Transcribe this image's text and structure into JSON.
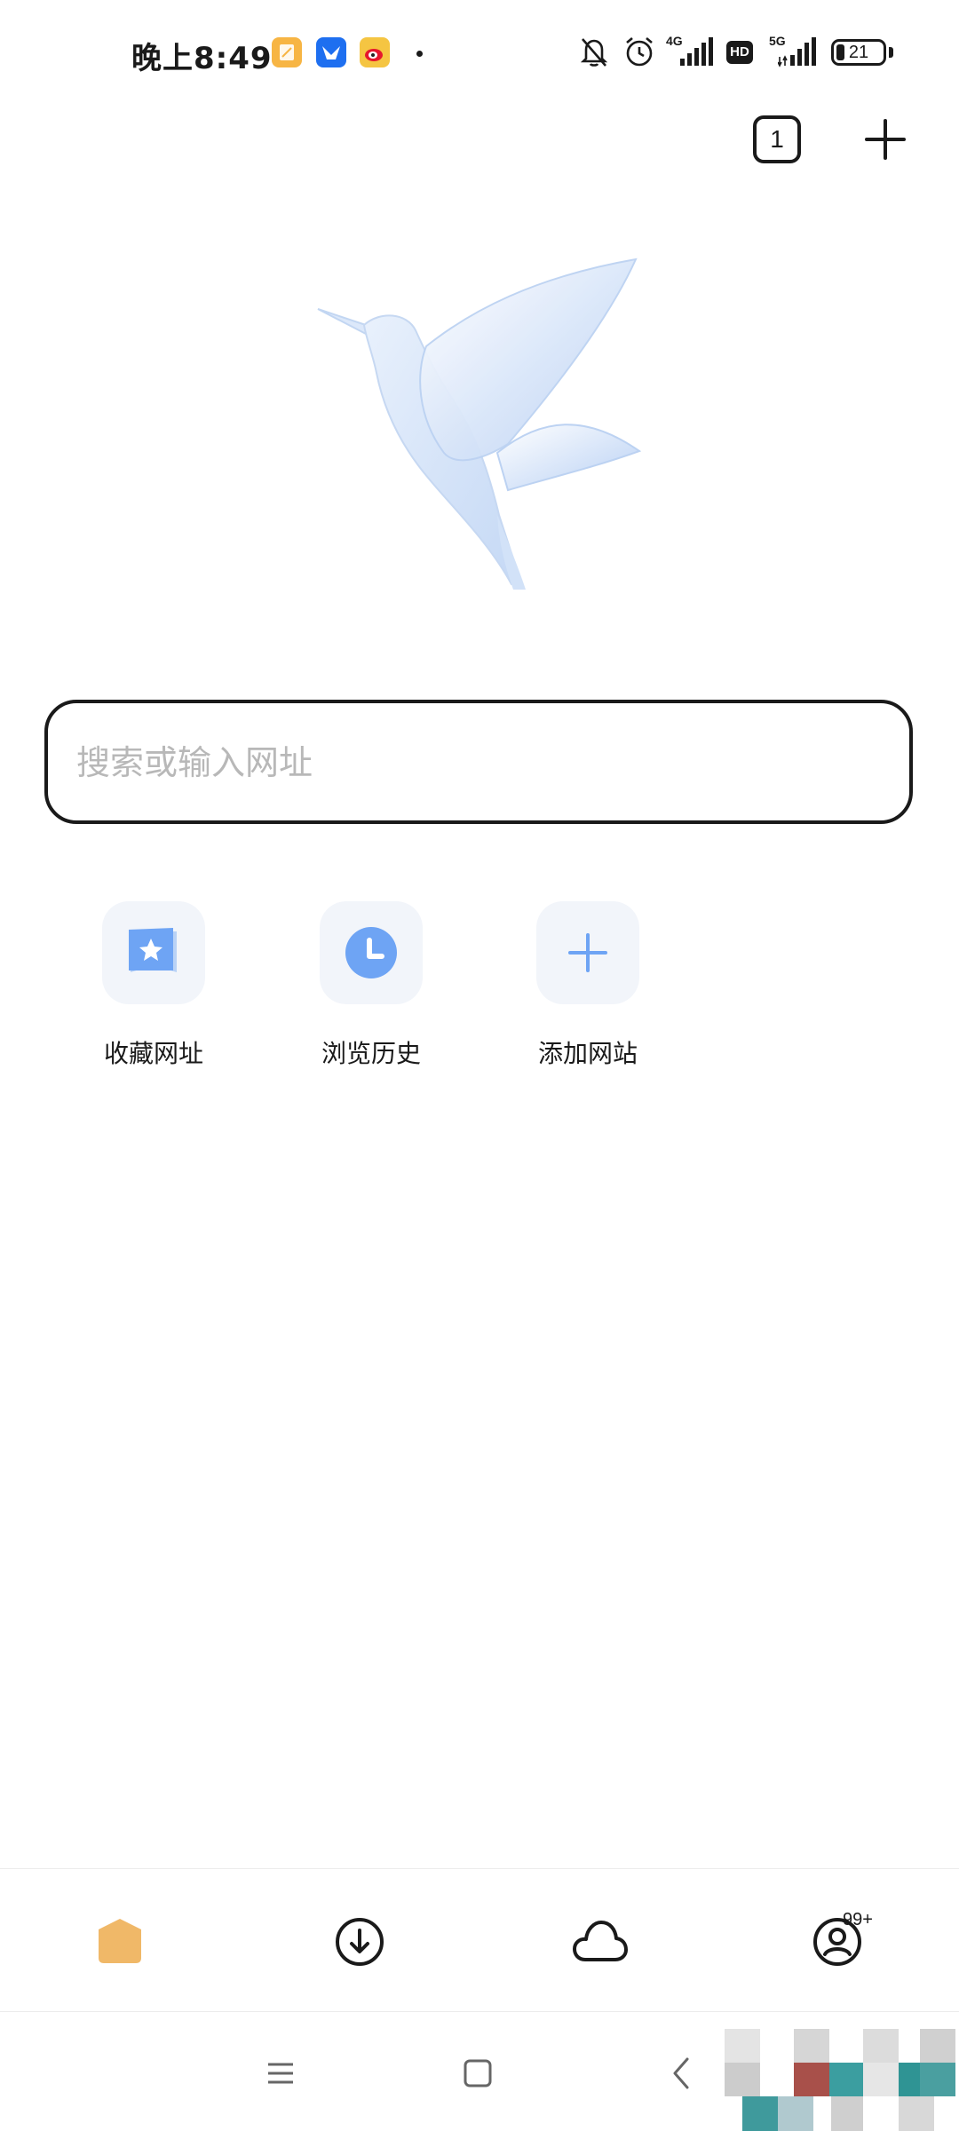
{
  "status_bar": {
    "time": "晚上8:49",
    "network_1": "4G",
    "network_2": "5G",
    "hd": "HD",
    "battery": "21"
  },
  "top_actions": {
    "tab_count": "1"
  },
  "search": {
    "placeholder": "搜索或输入网址"
  },
  "shortcuts": [
    {
      "label": "收藏网址",
      "icon": "bookmark-star-icon"
    },
    {
      "label": "浏览历史",
      "icon": "clock-icon"
    },
    {
      "label": "添加网站",
      "icon": "plus-icon"
    }
  ],
  "bottom_nav": {
    "items": [
      {
        "name": "home",
        "icon": "home-icon"
      },
      {
        "name": "downloads",
        "icon": "download-icon"
      },
      {
        "name": "cloud",
        "icon": "cloud-icon"
      },
      {
        "name": "profile",
        "icon": "user-icon"
      }
    ],
    "profile_badge": "99+"
  },
  "colors": {
    "accent_blue": "#6ea4f4",
    "home_orange": "#f0b868",
    "tile_bg": "#f2f5fa",
    "text": "#1a1a1a",
    "placeholder": "#b8b8b8"
  }
}
